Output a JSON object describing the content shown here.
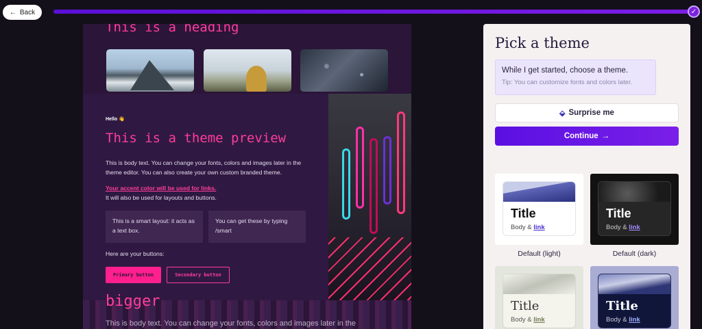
{
  "nav": {
    "back_label": "Back",
    "progress": 1.0
  },
  "preview": {
    "heading": "This is a heading",
    "hello": "Hello 👋",
    "title": "This is a theme preview",
    "body_text": "This is body text. You can change your fonts, colors and images later in the theme editor. You can also create your own custom branded theme.",
    "accent_link": "Your accent color will be used for links.",
    "body_text_2": "It will also be used for layouts and buttons.",
    "smart_box_1": "This is a smart layout: it acts as a text box.",
    "smart_box_2": "You can get these by typing /smart",
    "buttons_label": "Here are your buttons:",
    "primary_button": "Primary button",
    "secondary_button": "Secondary button",
    "bigger_heading": "bigger",
    "body_text_3": "This is body text. You can change your fonts, colors and images later in the"
  },
  "panel": {
    "title": "Pick a theme",
    "info_main": "While I get started, choose a theme.",
    "info_tip": "Tip: You can customize fonts and colors later.",
    "surprise_label": "Surprise me",
    "continue_label": "Continue",
    "themes": [
      {
        "name": "Default (light)",
        "card_title": "Title",
        "card_body": "Body &",
        "card_link": "link"
      },
      {
        "name": "Default (dark)",
        "card_title": "Title",
        "card_body": "Body &",
        "card_link": "link"
      },
      {
        "name": "",
        "card_title": "Title",
        "card_body": "Body &",
        "card_link": "link"
      },
      {
        "name": "",
        "card_title": "Title",
        "card_body": "Body &",
        "card_link": "link"
      }
    ]
  },
  "colors": {
    "accent": "#ff3d9a",
    "brand": "#6a18e4",
    "preview_bg": "#2b1538"
  }
}
